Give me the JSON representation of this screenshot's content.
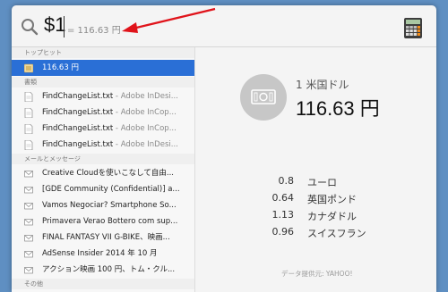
{
  "search": {
    "query": "$1",
    "hint": "= 116.63 円"
  },
  "sections": {
    "top_hit": "トップヒット",
    "documents": "書類",
    "mail": "メールとメッセージ",
    "other": "その他"
  },
  "top_hit": {
    "label": "116.63 円"
  },
  "documents": [
    {
      "name": "FindChangeList.txt",
      "sub": " - Adobe InDesi..."
    },
    {
      "name": "FindChangeList.txt",
      "sub": " - Adobe InCop..."
    },
    {
      "name": "FindChangeList.txt",
      "sub": " - Adobe InCop..."
    },
    {
      "name": "FindChangeList.txt",
      "sub": " - Adobe InDesi..."
    }
  ],
  "mail": [
    "Creative Cloudを使いこなして自由...",
    "[GDE Community (Confidential)] a...",
    "Vamos Negociar? Smartphone So...",
    "Primavera Verao Bottero com sup...",
    "FINAL FANTASY VII G-BIKE、映画...",
    "AdSense Insider 2014 年 10 月",
    "アクション映画 100 円、トム・クル..."
  ],
  "preview": {
    "unit": "1 米国ドル",
    "amount": "116.63 円",
    "conversions": [
      {
        "value": "0.8",
        "currency": "ユーロ"
      },
      {
        "value": "0.64",
        "currency": "英国ポンド"
      },
      {
        "value": "1.13",
        "currency": "カナダドル"
      },
      {
        "value": "0.96",
        "currency": "スイスフラン"
      }
    ],
    "credit": "データ提供元: YAHOO!"
  },
  "colors": {
    "selection": "#2a6fd6",
    "arrow": "#e0131a",
    "background": "#5f8fc2"
  }
}
